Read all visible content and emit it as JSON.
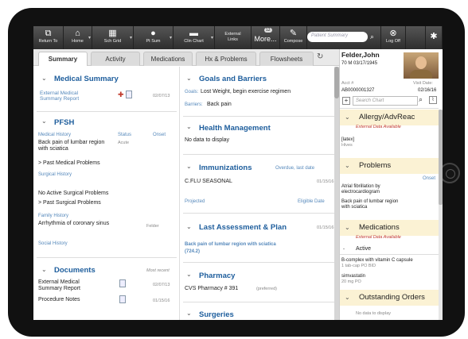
{
  "toolbar": {
    "return": "Return To",
    "home": "Home",
    "schgrid": "Sch Grid",
    "ptsum": "Pt Sum",
    "clinchart": "Clin Chart",
    "external": "External\nLinks",
    "more": "More...",
    "more_badge": "12",
    "compose": "Compose",
    "search_placeholder": "Patient Summary",
    "logoff": "Log Off"
  },
  "tabs": [
    "Summary",
    "Activity",
    "Medications",
    "Hx & Problems",
    "Flowsheets"
  ],
  "left": {
    "medsum": {
      "title": "Medical Summary",
      "item": "External Medical Summary Report",
      "date": "02/07/13"
    },
    "pfsh": {
      "title": "PFSH",
      "medhist": "Medical History",
      "status": "Status",
      "onset": "Onset",
      "item1": "Back pain of lumbar region with sciatica",
      "acute": "Acute",
      "past": "Past Medical Problems",
      "surghist": "Surgical History",
      "nosurg": "No Active Surgical Problems",
      "pastsurg": "Past Surgical Problems",
      "famhist": "Family History",
      "fam1": "Arrhythmia of coronary sinus",
      "fam1who": "Felder",
      "social": "Social History"
    },
    "docs": {
      "title": "Documents",
      "recent": "Most recent",
      "d1": "External Medical Summary Report",
      "d1date": "02/07/13",
      "d2": "Procedure Notes",
      "d2date": "01/15/16"
    }
  },
  "mid": {
    "goals": {
      "title": "Goals and Barriers",
      "goals_lbl": "Goals:",
      "goals_val": "Lost Weight, begin exercise regimen",
      "barriers_lbl": "Barriers:",
      "barriers_val": "Back pain"
    },
    "health": {
      "title": "Health Management",
      "empty": "No data to display"
    },
    "imm": {
      "title": "Immunizations",
      "overdue": "Overdue, last date",
      "item": "C.FLU SEASONAL",
      "date": "01/15/16",
      "projected": "Projected",
      "eligible": "Eligible Date"
    },
    "assess": {
      "title": "Last Assessment & Plan",
      "date": "01/15/16",
      "item": "Back pain of lumbar region with sciatica",
      "code": "(724.2)"
    },
    "pharm": {
      "title": "Pharmacy",
      "item": "CVS Pharmacy # 391",
      "pref": "(preferred)"
    },
    "surg": {
      "title": "Surgeries"
    }
  },
  "patient": {
    "name": "Felder,John",
    "info": "70 M 03/17/1945",
    "acct_lbl": "Acct #",
    "acct": "AB0000001327",
    "visit_lbl": "Visit Date:",
    "visit": "02/16/16",
    "search_placeholder": "Search Chart"
  },
  "right": {
    "allergy": {
      "title": "Allergy/AdvReac",
      "ext": "External Data Available",
      "item": "[latex]",
      "sub": "Hives"
    },
    "problems": {
      "title": "Problems",
      "onset": "Onset",
      "p1": "Atrial fibrillation by electrocardiogram",
      "p2": "Back pain of lumbar region with sciatica"
    },
    "meds": {
      "title": "Medications",
      "ext": "External Data Available",
      "active": "Active",
      "m1": "B-complex with vitamin C capsule",
      "m1sig": "1 tab-cap PO BID",
      "m2": "simvastatin",
      "m2sig": "20 mg PO"
    },
    "orders": {
      "title": "Outstanding Orders",
      "empty": "No data to display"
    }
  }
}
